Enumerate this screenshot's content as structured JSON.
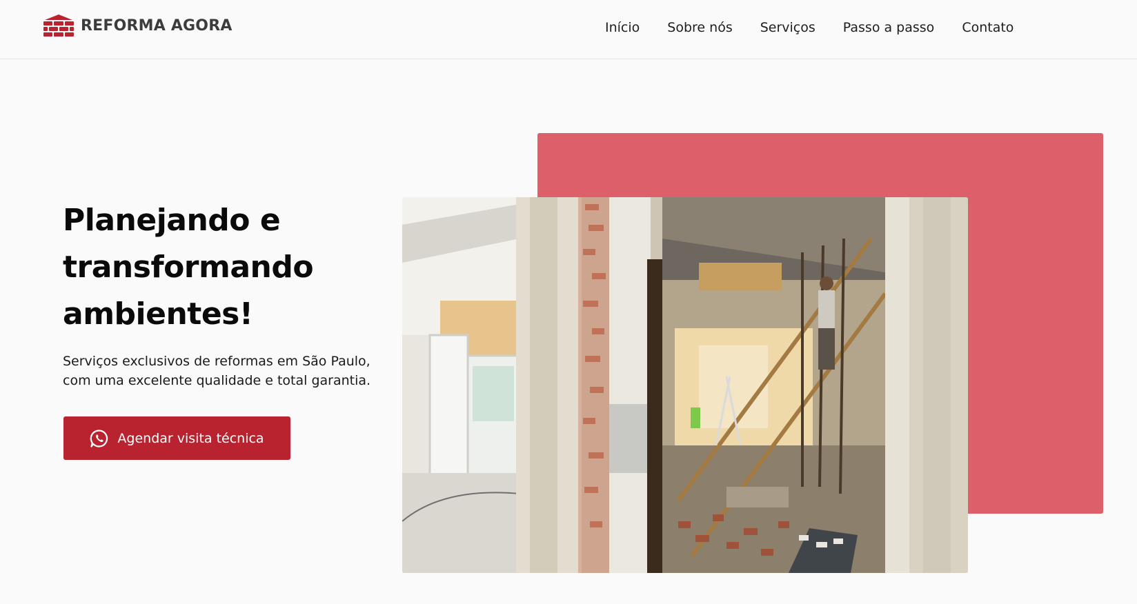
{
  "brand": {
    "name": "REFORMA AGORA",
    "logo_icon": "brick-wall-icon",
    "logo_color": "#b8232f"
  },
  "nav": {
    "items": [
      {
        "label": "Início"
      },
      {
        "label": "Sobre nós"
      },
      {
        "label": "Serviços"
      },
      {
        "label": "Passo a passo"
      },
      {
        "label": "Contato"
      }
    ]
  },
  "hero": {
    "title": "Planejando e transformando ambientes!",
    "subtitle": "Serviços exclusivos de reformas em São Paulo, com uma excelente qualidade e total garantia.",
    "cta": {
      "label": "Agendar visita técnica",
      "icon": "whatsapp-icon",
      "color": "#b8232f"
    },
    "image": {
      "icon": "renovation-photo"
    },
    "accent_color": "#dc5f69"
  }
}
